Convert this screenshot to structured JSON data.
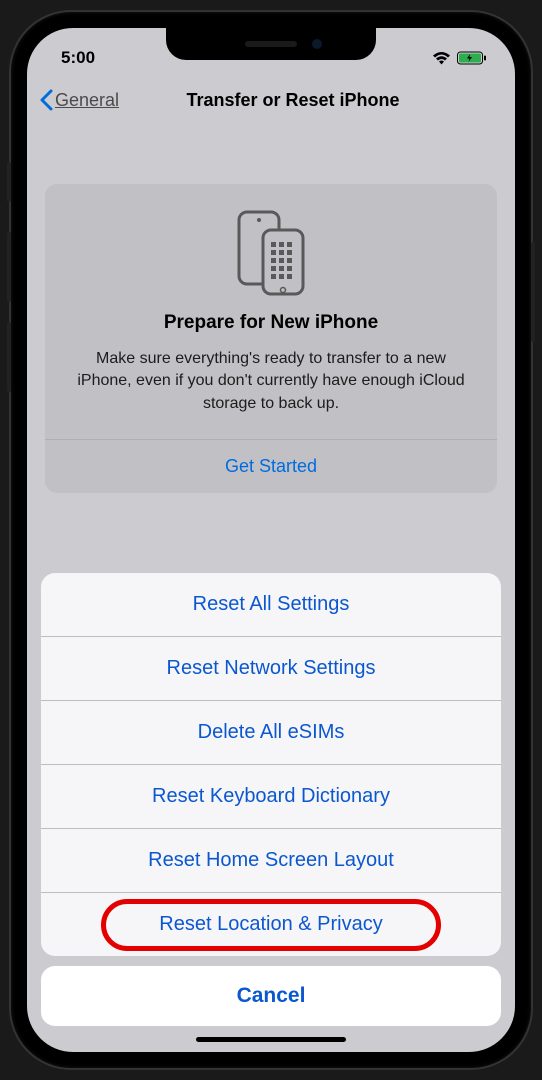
{
  "status": {
    "time": "5:00"
  },
  "nav": {
    "back_label": "General",
    "title": "Transfer or Reset iPhone"
  },
  "card": {
    "title": "Prepare for New iPhone",
    "text": "Make sure everything's ready to transfer to a new iPhone, even if you don't currently have enough iCloud storage to back up.",
    "cta": "Get Started"
  },
  "sheet": {
    "items": [
      "Reset All Settings",
      "Reset Network Settings",
      "Delete All eSIMs",
      "Reset Keyboard Dictionary",
      "Reset Home Screen Layout",
      "Reset Location & Privacy"
    ],
    "cancel": "Cancel"
  },
  "highlighted_index": 5
}
